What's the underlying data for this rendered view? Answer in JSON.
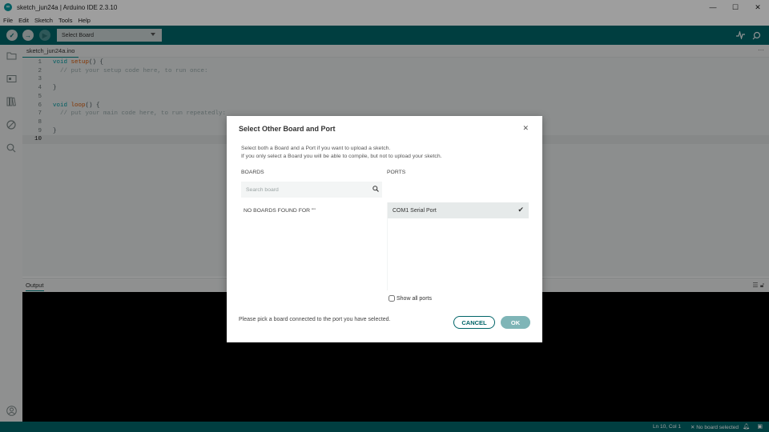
{
  "window": {
    "title": "sketch_jun24a | Arduino IDE 2.3.10",
    "app_icon": "arduino-logo-icon",
    "controls": [
      "minimize-icon",
      "maximize-icon",
      "close-icon"
    ]
  },
  "menu": {
    "items": [
      "File",
      "Edit",
      "Sketch",
      "Tools",
      "Help"
    ]
  },
  "toolbar": {
    "verify_icon": "check-icon",
    "upload_icon": "arrow-right-icon",
    "debug_icon": "debug-icon",
    "board_select_label": "Select Board",
    "serial_plotter_icon": "pulse-icon",
    "serial_monitor_icon": "magnifier-icon"
  },
  "sidebar": {
    "icons": [
      "folder-icon",
      "boards-manager-icon",
      "library-icon",
      "debug-off-icon",
      "search-icon"
    ],
    "bottom_icon": "account-icon"
  },
  "editor": {
    "tab_label": "sketch_jun24a.ino",
    "lines": [
      {
        "n": "1",
        "text": "void setup() {"
      },
      {
        "n": "2",
        "text": "  // put your setup code here, to run once:"
      },
      {
        "n": "3",
        "text": ""
      },
      {
        "n": "4",
        "text": "}"
      },
      {
        "n": "5",
        "text": ""
      },
      {
        "n": "6",
        "text": "void loop() {"
      },
      {
        "n": "7",
        "text": "  // put your main code here, to run repeatedly:"
      },
      {
        "n": "8",
        "text": ""
      },
      {
        "n": "9",
        "text": "}"
      },
      {
        "n": "10",
        "text": ""
      }
    ],
    "current_line": "10"
  },
  "output": {
    "title": "Output"
  },
  "status": {
    "position": "Ln 10, Col 1",
    "board": "No board selected"
  },
  "dialog": {
    "title": "Select Other Board and Port",
    "description_line1": "Select both a Board and a Port if you want to upload a sketch.",
    "description_line2": "If you only select a Board you will be able to compile, but not to upload your sketch.",
    "boards_label": "BOARDS",
    "ports_label": "PORTS",
    "search_placeholder": "Search board",
    "no_boards_text": "NO BOARDS FOUND FOR \"\"",
    "ports": [
      {
        "label": "COM1 Serial Port",
        "selected": true
      }
    ],
    "show_all_ports_label": "Show all ports",
    "show_all_ports_checked": false,
    "footer_text": "Please pick a board connected to the port you have selected.",
    "cancel_label": "CANCEL",
    "ok_label": "OK"
  },
  "colors": {
    "toolbar": "#006468",
    "accent": "#00979d",
    "ok_button_disabled": "#7fb5b7"
  }
}
